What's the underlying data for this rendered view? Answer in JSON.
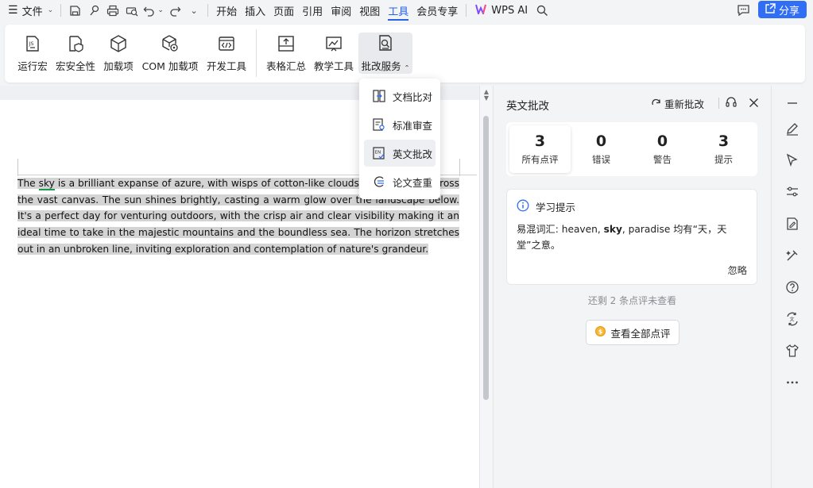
{
  "menubar": {
    "file_label": "文件",
    "tabs": [
      "开始",
      "插入",
      "页面",
      "引用",
      "审阅",
      "视图",
      "工具",
      "会员专享"
    ],
    "active_tab": "工具",
    "wps_ai_label": "WPS AI",
    "share_label": "分享"
  },
  "ribbon": {
    "buttons": [
      "运行宏",
      "宏安全性",
      "加载项",
      "COM 加载项",
      "开发工具",
      "表格汇总",
      "教学工具",
      "批改服务"
    ]
  },
  "dropdown": {
    "items": [
      "文档比对",
      "标准审查",
      "英文批改",
      "论文查重"
    ]
  },
  "document": {
    "t1": "The ",
    "t2": "sky",
    "t3": " is a brilliant expanse of azure, with wisps of cotton-like clouds drifting lazily across the vast canvas. The sun shines brightly, casting a warm glow over the landscape below. It's a perfect day for venturing outdoors, with the crisp air and clear visibility making it an ideal time to take in the majestic mountains and the boundless sea. The horizon stretches out in an unbroken line, inviting exploration and contemplation of nature's grandeur."
  },
  "panel": {
    "title": "英文批改",
    "recheck_label": "重新批改",
    "stats": [
      {
        "num": "3",
        "label": "所有点评"
      },
      {
        "num": "0",
        "label": "错误"
      },
      {
        "num": "0",
        "label": "警告"
      },
      {
        "num": "3",
        "label": "提示"
      }
    ],
    "tip": {
      "heading": "学习提示",
      "b1": "易混词汇: heaven, ",
      "b2": "sky",
      "b3": ", paradise 均有“天，天堂”之意。",
      "ignore": "忽略"
    },
    "remaining": "还剩 2 条点评未查看",
    "view_all": "查看全部点评"
  },
  "colors": {
    "accent": "#2563eb",
    "share_bg": "#2f6ef5",
    "selection": "#d4d4d4",
    "flag_underline": "#1a9b4b"
  }
}
